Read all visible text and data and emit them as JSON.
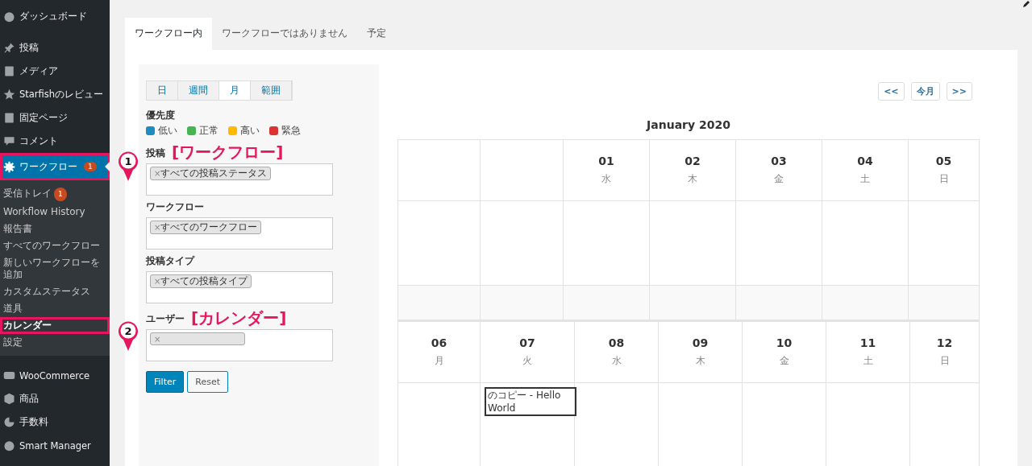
{
  "sidebar": {
    "items": [
      {
        "label": "ダッシュボード",
        "selected": false
      },
      {
        "label": "投稿",
        "selected": false
      },
      {
        "label": "メディア",
        "selected": false
      },
      {
        "label": "Starfishのレビュー",
        "selected": false
      },
      {
        "label": "固定ページ",
        "selected": false
      },
      {
        "label": "コメント",
        "selected": false
      },
      {
        "label": "ワークフロー",
        "badge": "1",
        "selected": true,
        "highlighted": true,
        "children": [
          {
            "label": "受信トレイ",
            "badge": "1",
            "selected": false,
            "highlighted": false
          },
          {
            "label": "Workflow History",
            "selected": false,
            "highlighted": false
          },
          {
            "label": "報告書",
            "selected": false,
            "highlighted": false
          },
          {
            "label": "すべてのワークフロー",
            "selected": false,
            "highlighted": false
          },
          {
            "label": "新しいワークフローを追加",
            "selected": false,
            "highlighted": false
          },
          {
            "label": "カスタムステータス",
            "selected": false,
            "highlighted": false
          },
          {
            "label": "道具",
            "selected": false,
            "highlighted": false
          },
          {
            "label": "カレンダー",
            "selected": true,
            "highlighted": true
          },
          {
            "label": "設定",
            "selected": false,
            "highlighted": false
          }
        ]
      },
      {
        "label": "WooCommerce",
        "selected": false
      },
      {
        "label": "商品",
        "selected": false
      },
      {
        "label": "手数料",
        "selected": false
      },
      {
        "label": "Smart Manager",
        "selected": false
      }
    ]
  },
  "tabs": [
    {
      "label": "ワークフロー内",
      "selected": true
    },
    {
      "label": "ワークフローではありません",
      "selected": false
    },
    {
      "label": "予定",
      "selected": false
    }
  ],
  "filters": {
    "views": [
      {
        "label": "日",
        "selected": false
      },
      {
        "label": "週間",
        "selected": false
      },
      {
        "label": "月",
        "selected": true
      },
      {
        "label": "範囲",
        "selected": false
      }
    ],
    "priority_label": "優先度",
    "priorities": [
      {
        "label": "低い",
        "color": "#1e8cbe"
      },
      {
        "label": "正常",
        "color": "#46b450"
      },
      {
        "label": "高い",
        "color": "#ffb900"
      },
      {
        "label": "緊急",
        "color": "#dc3232"
      }
    ],
    "fields": [
      {
        "label": "投稿",
        "chip": "すべての投稿ステータス"
      },
      {
        "label": "ワークフロー",
        "chip": "すべてのワークフロー"
      },
      {
        "label": "投稿タイプ",
        "chip": "すべての投稿タイプ"
      },
      {
        "label": "ユーザー"
      }
    ],
    "chip_remove": "×",
    "buttons": [
      {
        "label": "Filter",
        "kind": "primary"
      },
      {
        "label": "Reset",
        "kind": "secondary"
      }
    ]
  },
  "calendar": {
    "nav": [
      "<<",
      "今月",
      ">>"
    ],
    "title": "January 2020",
    "weeks": [
      {
        "days": [
          {
            "kind": "blank"
          },
          {
            "kind": "blank"
          },
          {
            "kind": "day",
            "date": "01",
            "weekday": "水"
          },
          {
            "kind": "day",
            "date": "02",
            "weekday": "木"
          },
          {
            "kind": "day",
            "date": "03",
            "weekday": "金"
          },
          {
            "kind": "day",
            "date": "04",
            "weekday": "土"
          },
          {
            "kind": "day",
            "date": "05",
            "weekday": "日"
          }
        ]
      },
      {
        "days": [
          {
            "kind": "day",
            "date": "06",
            "weekday": "月"
          },
          {
            "kind": "day",
            "date": "07",
            "weekday": "火",
            "events": [
              "のコピー - Hello World"
            ]
          },
          {
            "kind": "day",
            "date": "08",
            "weekday": "水"
          },
          {
            "kind": "day",
            "date": "09",
            "weekday": "木"
          },
          {
            "kind": "day",
            "date": "10",
            "weekday": "金"
          },
          {
            "kind": "day",
            "date": "11",
            "weekday": "土"
          },
          {
            "kind": "day",
            "date": "12",
            "weekday": "日"
          }
        ]
      }
    ]
  },
  "annotations": [
    {
      "number": "1",
      "text": "[ワークフロー]"
    },
    {
      "number": "2",
      "text": "[カレンダー]"
    }
  ]
}
